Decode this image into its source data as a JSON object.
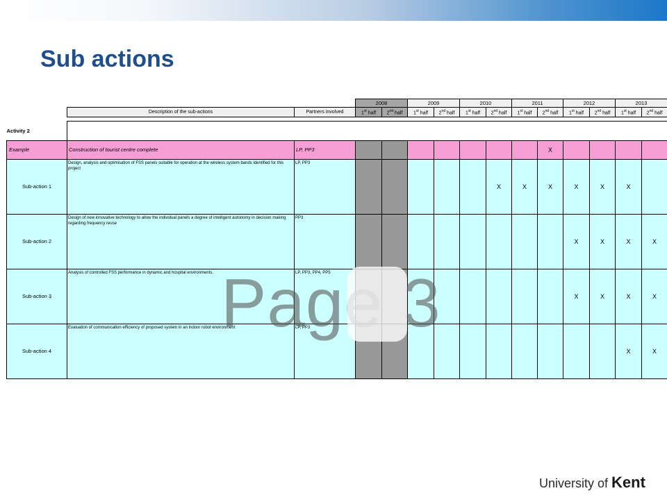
{
  "slide": {
    "title": "Sub actions",
    "watermark": "Page 3",
    "logo": {
      "prefix": "University of",
      "name": "Kent"
    }
  },
  "table": {
    "header": {
      "description": "Description of the sub-actions",
      "partners": "Partners involved",
      "years": [
        "2008",
        "2009",
        "2010",
        "2011",
        "2012",
        "2013"
      ],
      "half1": "1",
      "half1_sup": "st",
      "half2": "2",
      "half2_sup": "nd",
      "half_word": " half"
    },
    "activity": "Activity 2",
    "example": {
      "label": "Example",
      "description": "Construction of tourist centre complete",
      "partners": "LP, PP3",
      "marks": [
        "",
        "",
        "",
        "",
        "",
        "",
        "",
        "X",
        "",
        "",
        "",
        "",
        ""
      ]
    },
    "rows": [
      {
        "label": "Sub-action 1",
        "description": "Design, analysis and optimisation of FSS panels suitable for operation at the wireless system bands identified for this project",
        "partners": "LP, PP3",
        "marks": [
          "",
          "",
          "",
          "",
          "",
          "X",
          "X",
          "X",
          "X",
          "X",
          "X",
          ""
        ]
      },
      {
        "label": "Sub-action 2",
        "description": "Design of new innovative technology  to allow the individual panels a degree of intelligent autonomy in decision making regarding frequency reuse",
        "partners": "PP3",
        "marks": [
          "",
          "",
          "",
          "",
          "",
          "",
          "",
          "",
          "X",
          "X",
          "X",
          "X"
        ]
      },
      {
        "label": "Sub-action 3",
        "description": "Analysis of controlled FSS performance in dynamic and hospital environments.",
        "partners": "LP, PP3, PP4, PP5",
        "marks": [
          "",
          "",
          "",
          "",
          "",
          "",
          "",
          "",
          "X",
          "X",
          "X",
          "X"
        ]
      },
      {
        "label": "Sub-action 4",
        "description": "Evaluation of communication efficiency of proposed system in an indoor robot environment",
        "partners": "LP, PP3",
        "marks": [
          "",
          "",
          "",
          "",
          "",
          "",
          "",
          "",
          "",
          "",
          "X",
          "X"
        ]
      }
    ]
  },
  "colors": {
    "title": "#1f4e8c",
    "example_row": "#f79ed6",
    "subaction_rows": "#ccffff",
    "greyed_2008": "#999999",
    "header_2008": "#a6a6a6"
  }
}
